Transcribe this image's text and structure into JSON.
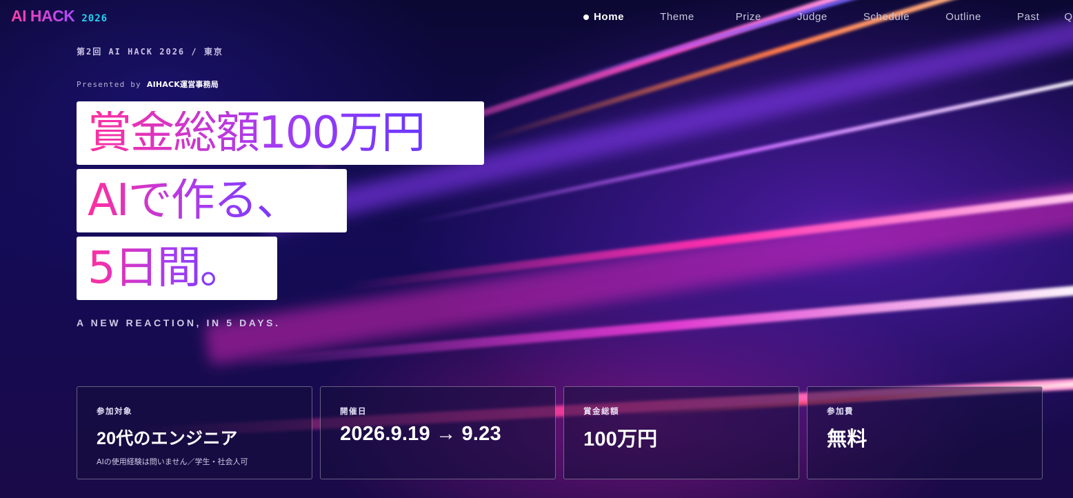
{
  "header": {
    "logo": "AI HACK",
    "logo_year": "2026",
    "nav": [
      {
        "label": "Home",
        "active": true
      },
      {
        "label": "Theme",
        "active": false
      },
      {
        "label": "Prize",
        "active": false
      },
      {
        "label": "Judge",
        "active": false
      },
      {
        "label": "Schedule",
        "active": false
      },
      {
        "label": "Outline",
        "active": false
      },
      {
        "label": "Past",
        "active": false
      },
      {
        "label": "Q",
        "active": false
      }
    ]
  },
  "hero": {
    "eyebrow": "第2回 AI HACK 2026 / 東京",
    "presented_by": "Presented by",
    "organizer": "AIHACK運営事務局",
    "headline": [
      "賞金総額100万円",
      "AIで作る、",
      "5日間。"
    ],
    "tagline": "A NEW REACTION, IN 5 DAYS."
  },
  "cards": [
    {
      "label": "参加対象",
      "value": "20代のエンジニア",
      "note": "AIの使用経験は問いません／学生・社会人可"
    },
    {
      "label": "開催日",
      "value": "2026.9.19 → 9.23",
      "note": ""
    },
    {
      "label": "賞金総額",
      "value": "100万円",
      "note": ""
    },
    {
      "label": "参加費",
      "value": "無料",
      "note": ""
    }
  ],
  "colors": {
    "accent_pink": "#ff2f9e",
    "accent_purple": "#a43cf3",
    "accent_cyan": "#22d3ee",
    "background": "#0a0730"
  }
}
